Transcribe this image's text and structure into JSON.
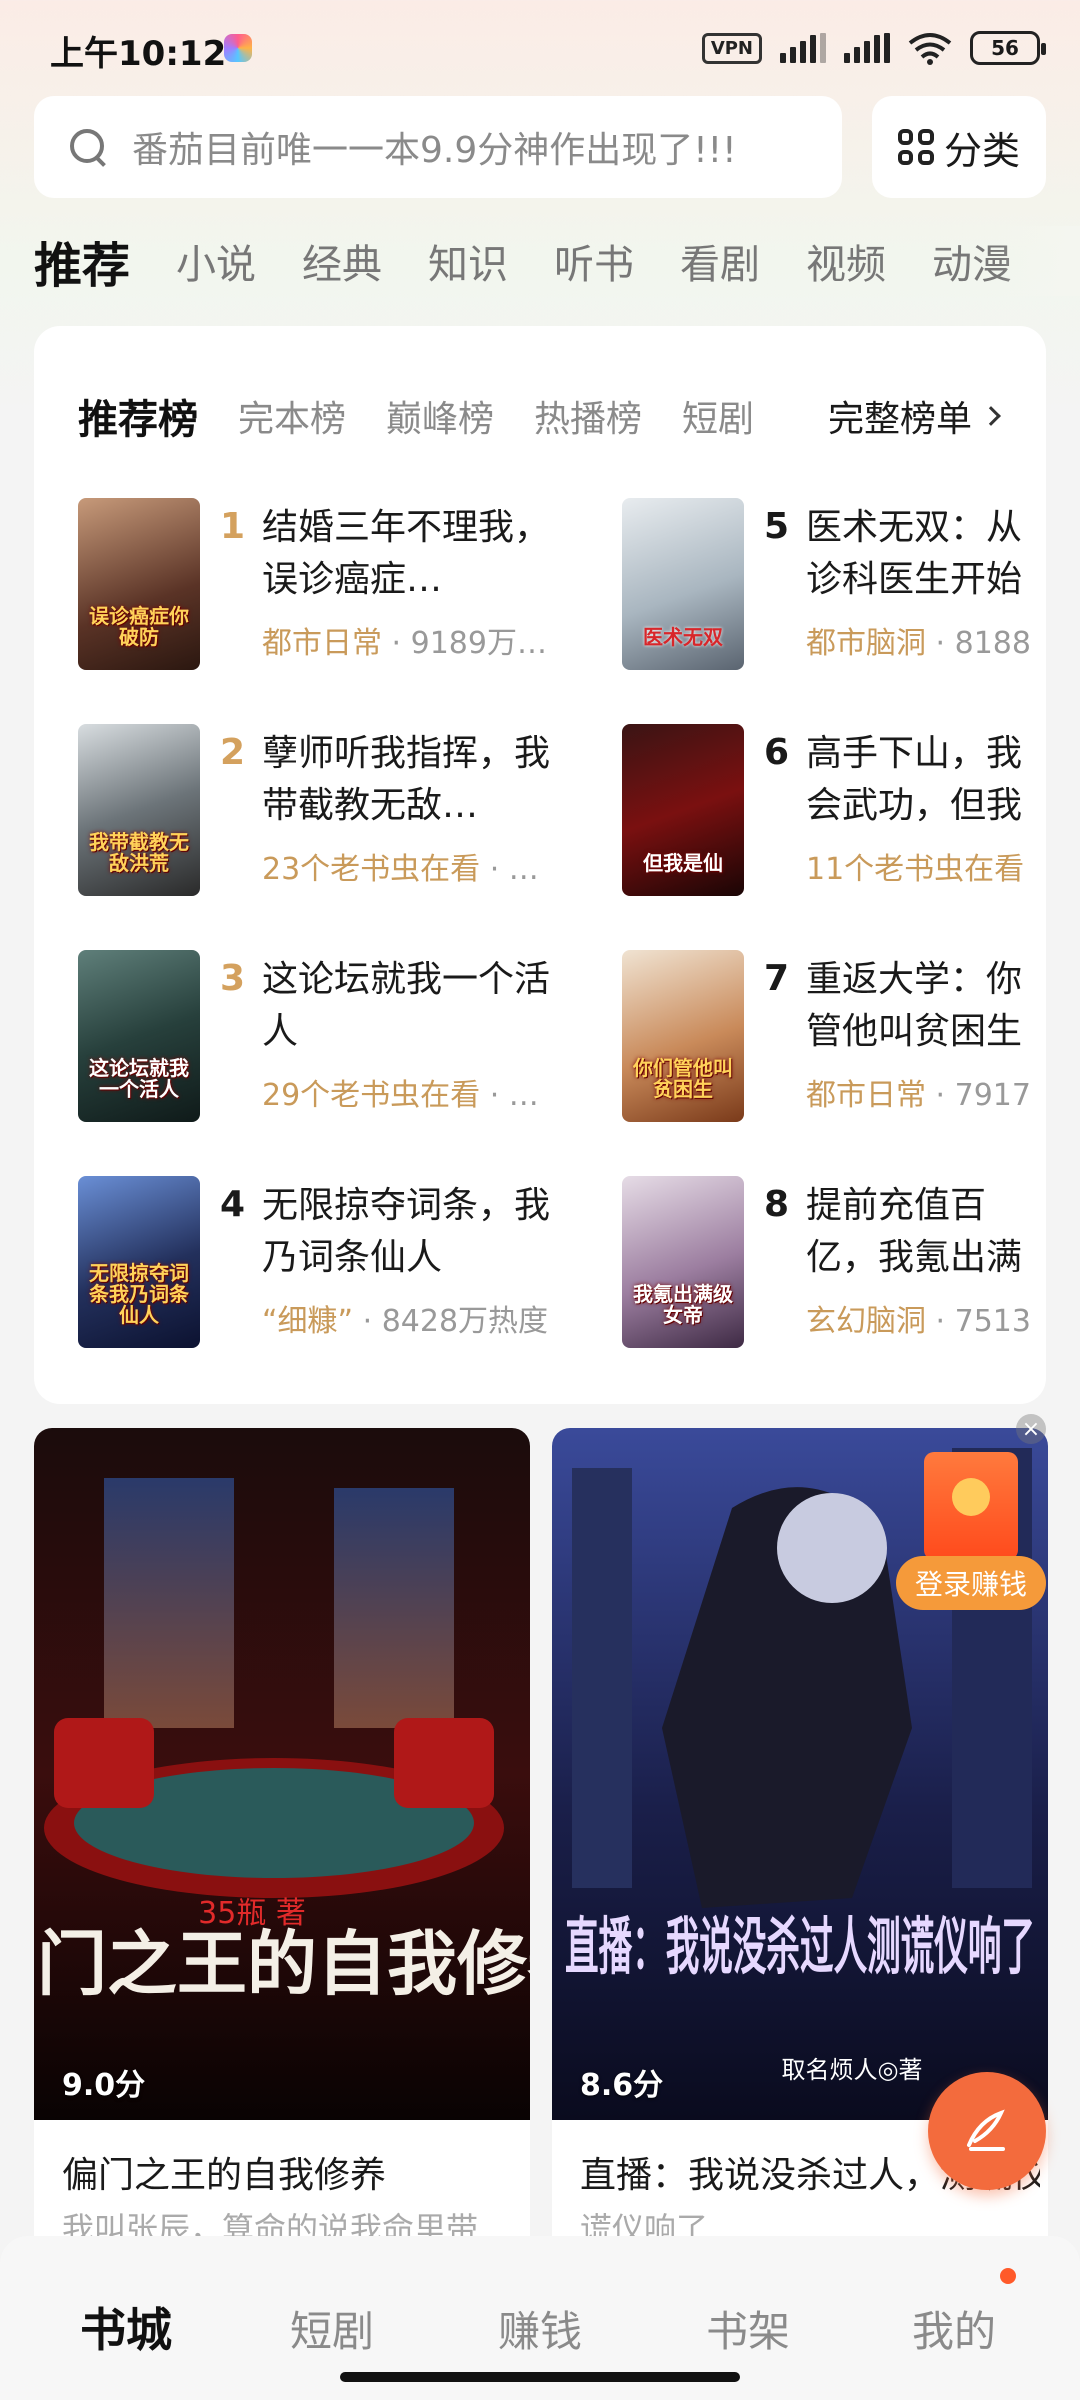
{
  "status_bar": {
    "time": "上午10:12",
    "vpn": "VPN",
    "battery": "56"
  },
  "search": {
    "placeholder": "番茄目前唯一一本9.9分神作出现了!!!"
  },
  "category_button": {
    "label": "分类"
  },
  "top_tabs": [
    "推荐",
    "小说",
    "经典",
    "知识",
    "听书",
    "看剧",
    "视频",
    "动漫"
  ],
  "ranking": {
    "tabs": [
      "推荐榜",
      "完本榜",
      "巅峰榜",
      "热播榜",
      "短剧"
    ],
    "full_list_label": "完整榜单",
    "books": [
      {
        "rank": "1",
        "title": "结婚三年不理我，误诊癌症…",
        "tag": "都市日常",
        "meta": " · 9189万…",
        "cover_text": "误诊癌症你破防"
      },
      {
        "rank": "2",
        "title": "孽师听我指挥，我带截教无敌…",
        "tag": "23个老书虫在看",
        "meta": " · …",
        "cover_text": "我带截教无敌洪荒"
      },
      {
        "rank": "3",
        "title": "这论坛就我一个活人",
        "tag": "29个老书虫在看",
        "meta": " · …",
        "cover_text": "这论坛就我一个活人"
      },
      {
        "rank": "4",
        "title": "无限掠夺词条，我乃词条仙人",
        "tag": "“细糠”",
        "meta": " · 8428万热度",
        "cover_text": "无限掠夺词条我乃词条仙人"
      },
      {
        "rank": "5",
        "title": "医术无双：从诊科医生开始",
        "tag": "都市脑洞",
        "meta": " · 8188",
        "cover_text": "医术无双"
      },
      {
        "rank": "6",
        "title": "高手下山，我会武功，但我",
        "tag": "11个老书虫在看",
        "meta": "",
        "cover_text": "但我是仙"
      },
      {
        "rank": "7",
        "title": "重返大学：你管他叫贫困生",
        "tag": "都市日常",
        "meta": " · 7917",
        "cover_text": "你们管他叫贫困生"
      },
      {
        "rank": "8",
        "title": "提前充值百亿，我氪出满级女",
        "tag": "玄幻脑洞",
        "meta": " · 7513",
        "cover_text": "我氪出满级女帝"
      }
    ]
  },
  "feed": [
    {
      "cover_title": "偏门之王的自我修养",
      "cover_author": "35瓶 著",
      "score": "9.0分",
      "title": "偏门之王的自我修养",
      "desc": "我叫张辰，算命的说我命里带"
    },
    {
      "cover_title": "直播：我说没杀过人测谎仪响了",
      "cover_author": "取名烦人◎著",
      "score": "8.6分",
      "title": "直播：我说没杀过人，测谎仪响了",
      "desc": "谎仪响了"
    }
  ],
  "login_reward": {
    "label": "登录赚钱"
  },
  "bottom_nav": [
    "书城",
    "短剧",
    "赚钱",
    "书架",
    "我的"
  ],
  "colors": {
    "accent": "#f36b3d",
    "tag": "#c99a5a",
    "rank_top": "#d4a15e"
  }
}
